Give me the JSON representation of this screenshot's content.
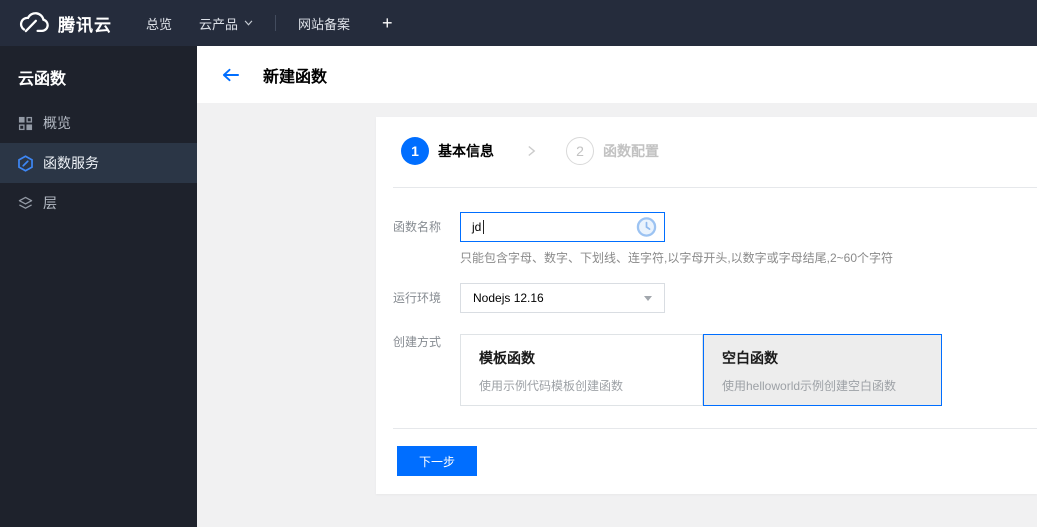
{
  "navbar": {
    "brand": {
      "label": "腾讯云",
      "logo_icon": "tencent-cloud-logo-icon"
    },
    "items": [
      {
        "label": "总览"
      },
      {
        "label": "云产品",
        "caret_icon": "chevron-down-icon"
      },
      {
        "label": "网站备案"
      },
      {
        "label": "+",
        "icon": "plus-icon"
      }
    ]
  },
  "sidebar": {
    "title": "云函数",
    "items": [
      {
        "label": "概览",
        "icon": "grid-icon",
        "active": false
      },
      {
        "label": "函数服务",
        "icon": "hexagon-function-icon",
        "active": true
      },
      {
        "label": "层",
        "icon": "layers-icon",
        "active": false
      }
    ]
  },
  "page_header": {
    "title": "新建函数",
    "back_icon": "back-arrow-icon"
  },
  "wizard": {
    "steps": [
      {
        "number": "1",
        "label": "基本信息",
        "state": "active"
      },
      {
        "number": "2",
        "label": "函数配置",
        "state": "upcoming"
      }
    ],
    "separator_icon": "chevron-right-icon"
  },
  "form": {
    "function_name": {
      "label": "函数名称",
      "value": "jd",
      "status_icon": "clock-loading-icon",
      "help": "只能包含字母、数字、下划线、连字符,以字母开头,以数字或字母结尾,2~60个字符"
    },
    "runtime": {
      "label": "运行环境",
      "value": "Nodejs 12.16",
      "caret_icon": "dropdown-caret-icon"
    },
    "creation_method": {
      "label": "创建方式",
      "options": [
        {
          "title": "模板函数",
          "desc": "使用示例代码模板创建函数",
          "selected": false
        },
        {
          "title": "空白函数",
          "desc": "使用helloworld示例创建空白函数",
          "selected": true
        }
      ]
    },
    "next_button": "下一步"
  },
  "colors": {
    "accent_blue": "#006eff",
    "navbar_bg": "#252c3c",
    "sidebar_bg": "#1e222c",
    "sidebar_active_bg": "#2b3646"
  }
}
